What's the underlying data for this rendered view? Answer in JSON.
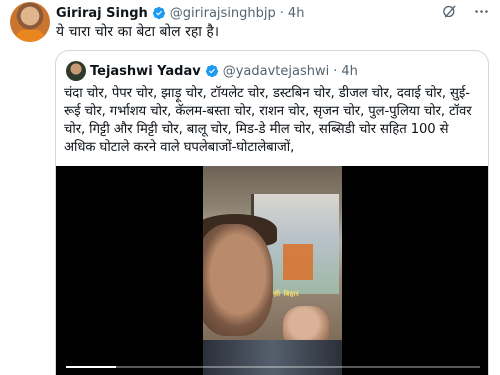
{
  "tweet": {
    "author_name": "Giriraj Singh",
    "handle": "@girirajsinghbjp",
    "separator": "·",
    "time": "4h",
    "text": "ये चारा चोर का बेटा बोल रहा है।"
  },
  "quoted_tweet": {
    "author_name": "Tejashwi Yadav",
    "handle": "@yadavtejashwi",
    "separator": "·",
    "time": "4h",
    "text": "चंदा चोर, पेपर चोर, झाड़ू चोर, टॉयलेट चोर, डस्टबिन चोर, डीजल चोर, दवाई चोर, सुई-रूई चोर, गर्भाशय चोर, कॅलम-बस्ता चोर, राशन चोर, सृजन चोर, पुल-पुलिया चोर, टॉवर चोर, गिट्टी और मिट्टी चोर, बालू चोर, मिड-डे मील चोर, सब्सिडी चोर सहित 100 से अधिक घोटाले करने वाले घपलेबाजों-घोटालेबाजों,"
  },
  "video": {
    "progress_fraction": 0.12,
    "overlay_label": "ज़ी बिहार"
  },
  "colors": {
    "verified": "#1d9bf0",
    "muted": "#536471",
    "border": "#cfd9de"
  },
  "icons": [
    "verified-badge-icon",
    "grok-icon",
    "more-options-icon"
  ]
}
